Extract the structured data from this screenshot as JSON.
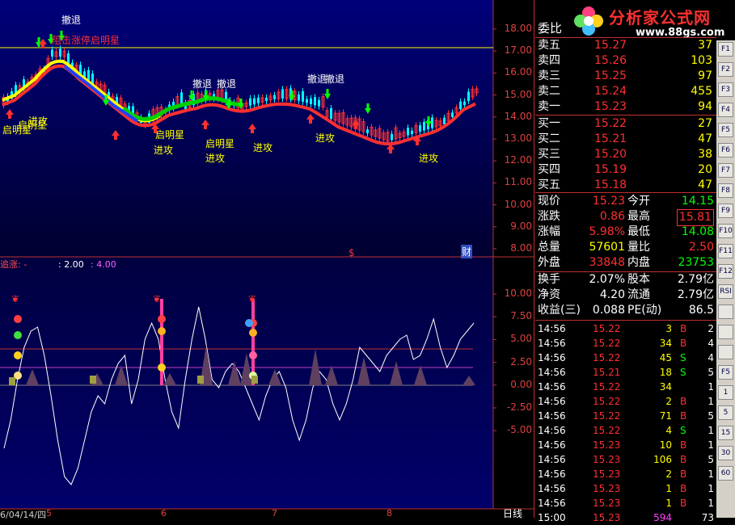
{
  "brand": {
    "logo_text": "分析家公式网",
    "url": "www.88gs.com"
  },
  "main_chart": {
    "annotations": {
      "retreat": "撤退",
      "attack": "进攻",
      "morning_star": "启明星",
      "limit_up": "阻击涨停启明星"
    },
    "price_axis": [
      "18.00",
      "17.00",
      "16.00",
      "15.00",
      "14.00",
      "13.00",
      "12.00",
      "11.00",
      "10.00",
      "9.00",
      "8.00"
    ],
    "marker_s": "$",
    "marker_cai": "财"
  },
  "sub_chart": {
    "title": "追涨: -",
    "param1": ": 2.00",
    "param2": ": 4.00",
    "axis": [
      "10.00",
      "7.50",
      "5.00",
      "2.50",
      "0.00",
      "-2.50",
      "-5.00"
    ]
  },
  "date_axis": {
    "first": "6/04/14/四",
    "labels": [
      "5",
      "6",
      "7",
      "8"
    ],
    "period": "日线"
  },
  "quote": {
    "weibi_label": "委比",
    "asks": [
      {
        "label": "卖五",
        "price": "15.27",
        "vol": "37"
      },
      {
        "label": "卖四",
        "price": "15.26",
        "vol": "103"
      },
      {
        "label": "卖三",
        "price": "15.25",
        "vol": "97"
      },
      {
        "label": "卖二",
        "price": "15.24",
        "vol": "455"
      },
      {
        "label": "卖一",
        "price": "15.23",
        "vol": "94"
      }
    ],
    "bids": [
      {
        "label": "买一",
        "price": "15.22",
        "vol": "27"
      },
      {
        "label": "买二",
        "price": "15.21",
        "vol": "47"
      },
      {
        "label": "买三",
        "price": "15.20",
        "vol": "38"
      },
      {
        "label": "买四",
        "price": "15.19",
        "vol": "20"
      },
      {
        "label": "买五",
        "price": "15.18",
        "vol": "47"
      }
    ],
    "stats": [
      {
        "l1": "现价",
        "v1": "15.23",
        "l2": "今开",
        "v2": "14.15"
      },
      {
        "l1": "涨跌",
        "v1": "0.86",
        "l2": "最高",
        "v2": "15.81"
      },
      {
        "l1": "涨幅",
        "v1": "5.98%",
        "l2": "最低",
        "v2": "14.08"
      },
      {
        "l1": "总量",
        "v1": "57601",
        "l2": "量比",
        "v2": "2.50"
      },
      {
        "l1": "外盘",
        "v1": "33848",
        "l2": "内盘",
        "v2": "23753"
      }
    ],
    "stats2": [
      {
        "l1": "换手",
        "v1": "2.07%",
        "l2": "股本",
        "v2": "2.79亿"
      },
      {
        "l1": "净资",
        "v1": "4.20",
        "l2": "流通",
        "v2": "2.79亿"
      },
      {
        "l1": "收益(三)",
        "v1": "0.088",
        "l2": "PE(动)",
        "v2": "86.5"
      }
    ]
  },
  "ticks": [
    {
      "time": "14:56",
      "price": "15.22",
      "vol": "3",
      "side": "B",
      "n": "2"
    },
    {
      "time": "14:56",
      "price": "15.22",
      "vol": "34",
      "side": "B",
      "n": "4"
    },
    {
      "time": "14:56",
      "price": "15.22",
      "vol": "45",
      "side": "S",
      "n": "4"
    },
    {
      "time": "14:56",
      "price": "15.21",
      "vol": "18",
      "side": "S",
      "n": "5"
    },
    {
      "time": "14:56",
      "price": "15.22",
      "vol": "34",
      "side": "",
      "n": "1"
    },
    {
      "time": "14:56",
      "price": "15.22",
      "vol": "2",
      "side": "B",
      "n": "1"
    },
    {
      "time": "14:56",
      "price": "15.22",
      "vol": "71",
      "side": "B",
      "n": "5"
    },
    {
      "time": "14:56",
      "price": "15.22",
      "vol": "4",
      "side": "S",
      "n": "1"
    },
    {
      "time": "14:56",
      "price": "15.23",
      "vol": "10",
      "side": "B",
      "n": "1"
    },
    {
      "time": "14:56",
      "price": "15.23",
      "vol": "106",
      "side": "B",
      "n": "5"
    },
    {
      "time": "14:56",
      "price": "15.23",
      "vol": "2",
      "side": "B",
      "n": "1"
    },
    {
      "time": "14:56",
      "price": "15.23",
      "vol": "1",
      "side": "B",
      "n": "1"
    },
    {
      "time": "14:56",
      "price": "15.23",
      "vol": "1",
      "side": "B",
      "n": "1"
    },
    {
      "time": "15:00",
      "price": "15.23",
      "vol": "594",
      "side": "",
      "n": "73"
    }
  ],
  "toolbar": [
    "F1",
    "F2",
    "F3",
    "F4",
    "F5",
    "F6",
    "F7",
    "F8",
    "F9",
    "F10",
    "F11",
    "F12",
    "RSI",
    "",
    "",
    "",
    "F5",
    "1",
    "5",
    "15",
    "30",
    "60"
  ],
  "colors": {
    "up": "#ff3030",
    "down": "#00ffff",
    "yellow": "#ffff00",
    "green": "#00e000",
    "bg_top": "#000060"
  }
}
